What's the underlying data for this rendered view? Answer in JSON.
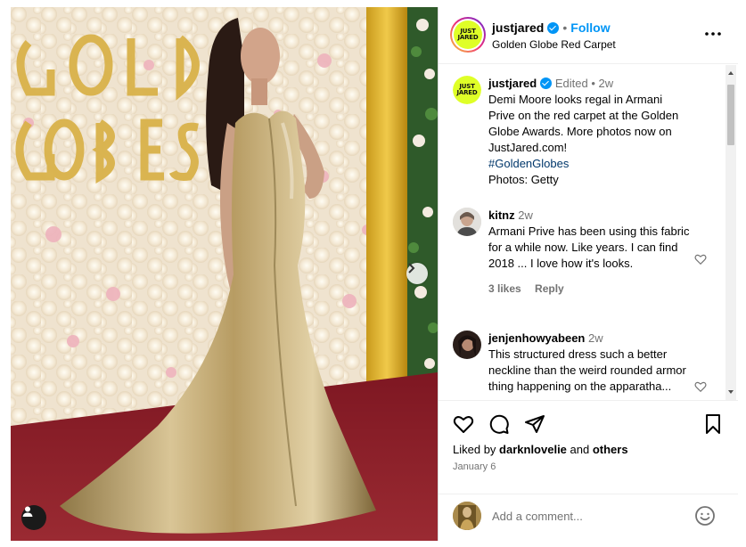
{
  "post": {
    "author": "justjared",
    "logo_text": [
      "JUST",
      "JARED"
    ],
    "follow_label": "Follow",
    "dot": "•",
    "location": "Golden Globe Red Carpet"
  },
  "caption": {
    "author": "justjared",
    "edited": "Edited",
    "dot": "•",
    "age": "2w",
    "text": "Demi Moore looks regal in Armani Prive on the red carpet at the Golden Globe Awards. More photos now on JustJared.com!",
    "hashtag": "#GoldenGlobes",
    "credit": "Photos: Getty"
  },
  "comments": [
    {
      "user": "kitnz",
      "age": "2w",
      "text": "Armani Prive has been using this fabric for a while now. Like years. I can find 2018 ... I love how it's looks.",
      "likes": "3 likes",
      "reply_label": "Reply"
    },
    {
      "user": "jenjenhowyabeen",
      "age": "2w",
      "text": "This structured dress such a better neckline than the weird rounded armor thing happening on the apparatha..."
    }
  ],
  "likes": {
    "prefix": "Liked by ",
    "user": "darknlovelie",
    "and": " and ",
    "others": "others"
  },
  "date": "January 6",
  "comment_input": {
    "placeholder": "Add a comment..."
  },
  "icons": {
    "like": "heart-icon",
    "comment": "comment-bubble-icon",
    "share": "paper-plane-icon",
    "save": "bookmark-icon",
    "more": "more-horizontal-icon",
    "emoji": "smiley-icon",
    "next": "chevron-right-icon",
    "tagged_user": "user-icon"
  },
  "colors": {
    "verified": "#0095f6",
    "follow": "#0095f6",
    "logo_bg": "#dfff27",
    "hashtag": "#00376b",
    "red_carpet": "#8f1f2a",
    "gold_dress": "#b9a06a"
  }
}
